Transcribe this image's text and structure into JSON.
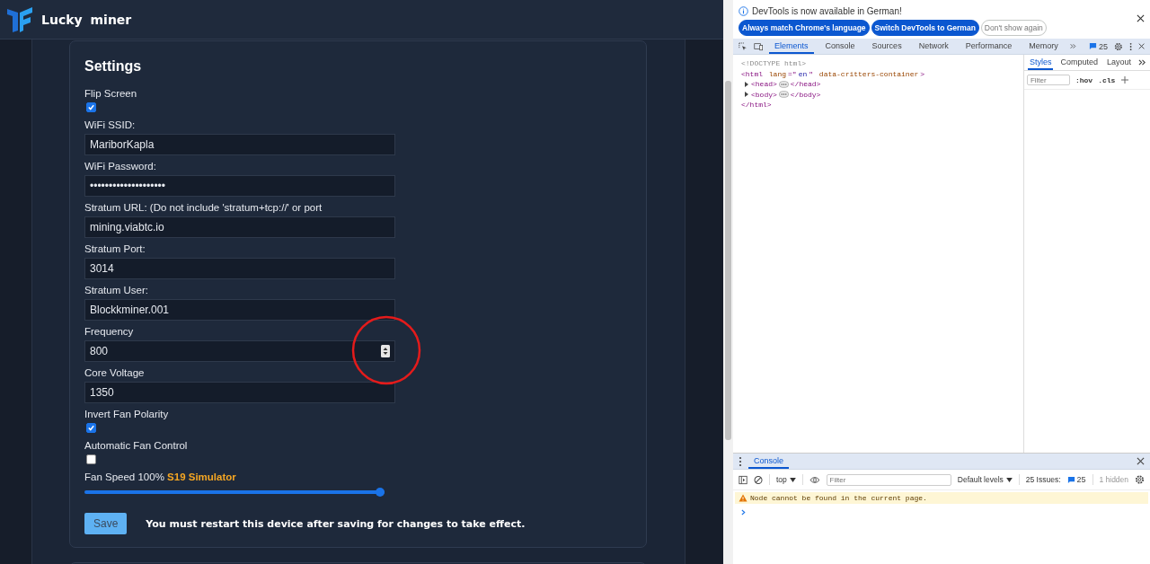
{
  "app": {
    "title": "Lucky miner"
  },
  "settings": {
    "title": "Settings",
    "fields": [
      {
        "kind": "checkbox",
        "label": "Flip Screen",
        "checked": true
      },
      {
        "kind": "text",
        "label": "WiFi SSID:",
        "value": "MariborKapla"
      },
      {
        "kind": "text",
        "label": "WiFi Password:",
        "value": "••••••••••••••••••••"
      },
      {
        "kind": "text",
        "label": "Stratum URL: (Do not include 'stratum+tcp://' or port",
        "value": "mining.viabtc.io"
      },
      {
        "kind": "text",
        "label": "Stratum Port:",
        "value": "3014"
      },
      {
        "kind": "text",
        "label": "Stratum User:",
        "value": "Blockkminer.001"
      },
      {
        "kind": "number",
        "label": "Frequency",
        "value": "800"
      },
      {
        "kind": "text",
        "label": "Core Voltage",
        "value": "1350"
      },
      {
        "kind": "checkbox",
        "label": "Invert Fan Polarity",
        "checked": true
      },
      {
        "kind": "checkbox",
        "label": "Automatic Fan Control",
        "checked": false
      },
      {
        "kind": "slider",
        "label": "Fan Speed 100%",
        "tag": "S19 Simulator",
        "level": 1
      }
    ],
    "save_button": "Save",
    "notice": "You must restart this device after saving for changes to take effect."
  },
  "devtools": {
    "infobar": {
      "message": "DevTools is now available in German!",
      "buttons": [
        {
          "label": "Always match Chrome's language",
          "kind": "primary"
        },
        {
          "label": "Switch DevTools to German",
          "kind": "primary"
        },
        {
          "label": "Don't show again",
          "kind": "outline"
        }
      ]
    },
    "tabs": [
      {
        "label": "Elements",
        "selected": true
      },
      {
        "label": "Console",
        "selected": false
      },
      {
        "label": "Sources",
        "selected": false
      },
      {
        "label": "Network",
        "selected": false
      },
      {
        "label": "Performance",
        "selected": false
      },
      {
        "label": "Memory",
        "selected": false
      }
    ],
    "issues_count": "25",
    "dom": [
      {
        "open": [
          {
            "kind": "doctype",
            "text": "<!DOCTYPE html>"
          }
        ]
      },
      {
        "open": [
          {
            "kind": "tag",
            "text": "<html "
          },
          {
            "kind": "attr",
            "text": "lang"
          },
          {
            "kind": "tag",
            "text": "=\""
          },
          {
            "kind": "value",
            "text": "en"
          },
          {
            "kind": "tag",
            "text": "\" "
          },
          {
            "kind": "attr",
            "text": "data-critters-container"
          },
          {
            "kind": "tag",
            "text": ">"
          }
        ],
        "children": [
          {
            "open": [
              {
                "kind": "tag",
                "text": "<head>"
              }
            ],
            "close": [
              {
                "kind": "tag",
                "text": "</head>"
              }
            ],
            "expanded": false
          },
          {
            "open": [
              {
                "kind": "tag",
                "text": "<body>"
              }
            ],
            "close": [
              {
                "kind": "tag",
                "text": "</body>"
              }
            ],
            "expanded": false
          }
        ]
      },
      {
        "open": [
          {
            "kind": "tag",
            "text": "</html>"
          }
        ]
      }
    ],
    "side_tabs": [
      {
        "label": "Styles",
        "selected": true
      },
      {
        "label": "Computed",
        "selected": false
      },
      {
        "label": "Layout",
        "selected": false
      }
    ],
    "styles_filter": {
      "placeholder": "Filter"
    },
    "hov": ":hov",
    "cls": ".cls",
    "drawer": {
      "tab": {
        "label": "Console",
        "selected": true
      },
      "context": "top",
      "filter": {
        "placeholder": "Filter"
      },
      "levels": "Default levels",
      "issues_label": "25 Issues:",
      "issues_count": "25",
      "hidden": "1 hidden",
      "messages": [
        {
          "kind": "warning",
          "text": "Node cannot be found in the current page."
        }
      ]
    }
  }
}
